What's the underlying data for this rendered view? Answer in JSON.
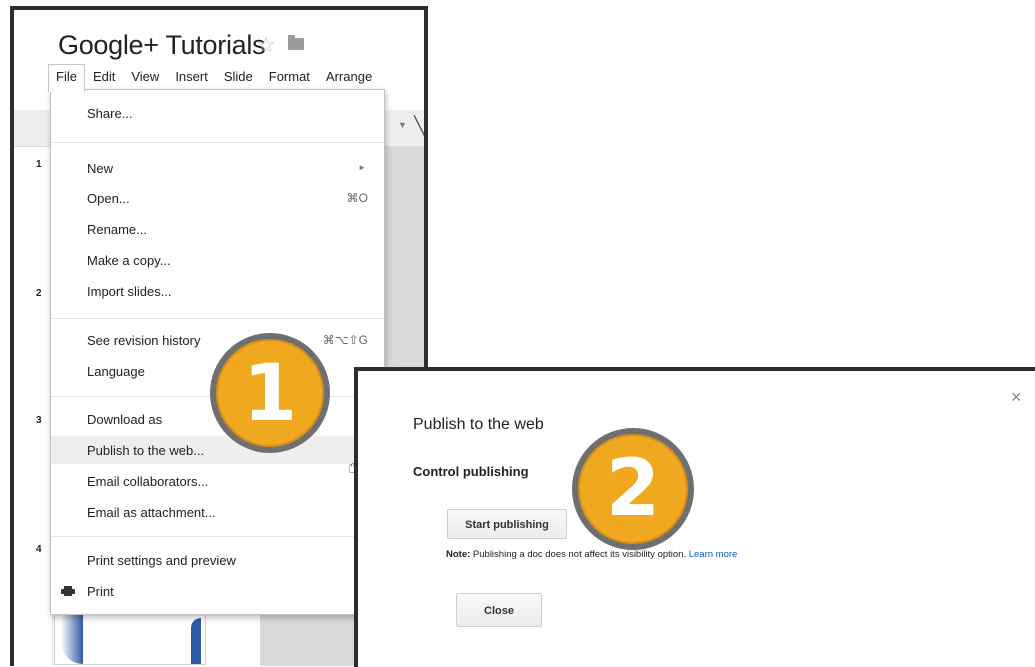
{
  "document": {
    "title": "Google+ Tutorials"
  },
  "menubar": [
    "File",
    "Edit",
    "View",
    "Insert",
    "Slide",
    "Format",
    "Arrange"
  ],
  "file_menu": {
    "share": "Share...",
    "new": "New",
    "open": "Open...",
    "open_shortcut": "⌘O",
    "rename": "Rename...",
    "make_copy": "Make a copy...",
    "import_slides": "Import slides...",
    "revision_history": "See revision history",
    "revision_shortcut": "⌘⌥⇧G",
    "language": "Language",
    "download_as": "Download as",
    "publish": "Publish to the web...",
    "email_collaborators": "Email collaborators...",
    "email_attachment": "Email as attachment...",
    "print_settings": "Print settings and preview",
    "print": "Print"
  },
  "slide_numbers": [
    "1",
    "2",
    "3",
    "4"
  ],
  "badges": {
    "step1": "1",
    "step2": "2"
  },
  "dialog": {
    "title": "Publish to the web",
    "close_glyph": "×",
    "section": "Control publishing",
    "start_button": "Start publishing",
    "note_label": "Note:",
    "note_text": " Publishing a doc does not affect its visibility option. ",
    "learn_more": "Learn more",
    "close_button": "Close"
  },
  "colors": {
    "badge": "#f0a91f",
    "badge_ring": "#6f6f6f",
    "link": "#1155cc",
    "frame": "#2d2d2d"
  },
  "icons": {
    "star": "star-icon",
    "folder": "folder-icon",
    "print": "printer-icon",
    "cursor": "hand-pointer-icon",
    "close": "close-icon"
  }
}
